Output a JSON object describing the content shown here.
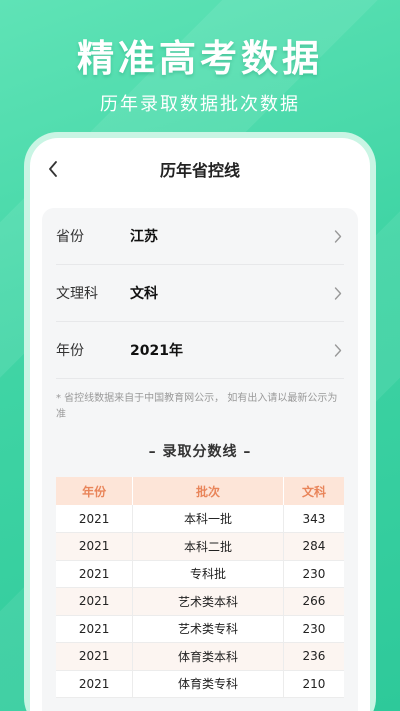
{
  "promo": {
    "headline": "精准高考数据",
    "subhead": "历年录取数据批次数据"
  },
  "nav": {
    "title": "历年省控线"
  },
  "filters": [
    {
      "label": "省份",
      "value": "江苏"
    },
    {
      "label": "文理科",
      "value": "文科"
    },
    {
      "label": "年份",
      "value": "2021年"
    }
  ],
  "note": "* 省控线数据来自于中国教育网公示， 如有出入请以最新公示为准",
  "section_title": "– 录取分数线 –",
  "table": {
    "headers": [
      "年份",
      "批次",
      "文科"
    ],
    "rows": [
      [
        "2021",
        "本科一批",
        "343"
      ],
      [
        "2021",
        "本科二批",
        "284"
      ],
      [
        "2021",
        "专科批",
        "230"
      ],
      [
        "2021",
        "艺术类本科",
        "266"
      ],
      [
        "2021",
        "艺术类专科",
        "230"
      ],
      [
        "2021",
        "体育类本科",
        "236"
      ],
      [
        "2021",
        "体育类专科",
        "210"
      ]
    ]
  },
  "colors": {
    "brand_green": "#3fd4a4",
    "table_header_bg": "#fde5d8",
    "table_header_text": "#e9855a"
  },
  "icons": {
    "back": "chevron-left-icon",
    "row_arrow": "chevron-right-icon"
  }
}
